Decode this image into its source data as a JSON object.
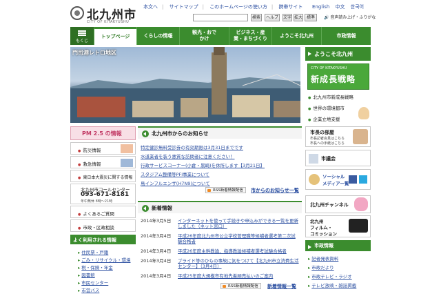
{
  "header": {
    "logo_title": "北九州市",
    "logo_sub": "CITY OF KITAKYUSHU",
    "links": [
      "本文へ",
      "サイトマップ",
      "このホームページの使い方",
      "携帯サイト"
    ],
    "lang": [
      "English",
      "中文",
      "한국어"
    ],
    "search_button": "検索",
    "help_button": "ヘルプ",
    "text_button": "文字",
    "zoom_button": "拡大",
    "standard_button": "標準",
    "voice": "音声読み上げ・ふりがな"
  },
  "nav": {
    "menu": "もくじ",
    "items": [
      "トップページ",
      "くらしの情報",
      "観光・おでかけ",
      "ビジネス・産業・まちづくり",
      "ようこそ北九州",
      "市政情報"
    ]
  },
  "hero": {
    "label": "門司港レトロ地区"
  },
  "right": {
    "welcome": "ようこそ北九州",
    "banner_sub": "CITY OF KITAKYUSHU",
    "banner_title": "新成長戦略",
    "list": [
      "北九州市新成長戦略",
      "世界の環境都市",
      "企業立地支援"
    ],
    "mayor_title": "市長の部屋",
    "mayor_sub": [
      "市長記者会見はこちら",
      "市長への手紙はこちら"
    ],
    "council": "市議会",
    "social": [
      "ソーシャル",
      "メディア一覧"
    ],
    "channel": "北九州チャンネル",
    "film": [
      "北九州",
      "フィルム・",
      "コミッション"
    ],
    "shisei": "市政情報",
    "shisei_links": [
      "記者発表資料",
      "市政だより",
      "市政テレビ・ラジオ",
      "テレビ放映・雑誌掲載"
    ]
  },
  "left": {
    "pm": "PM 2.5 の情報",
    "items": [
      "防災情報",
      "救急情報",
      "東日本大震災に関する情報"
    ],
    "callcenter": "北九州市コールセンター",
    "phone": "093-671-8181",
    "hours": "年中無休 8時～21時",
    "faq": "よくあるご質問",
    "window": "市政・区政相談",
    "popular": "よく利用される情報",
    "popular_links": [
      "住民票・戸籍",
      "ごみ・リサイクル・環境",
      "税・保険・年金",
      "図書館",
      "市民センター",
      "市営バス"
    ]
  },
  "notices": {
    "title": "北九州市からのお知らせ",
    "items": [
      "特定健診無料受診券の有効期限は3月31日までです",
      "水道業者を装う悪質な訪問者に注意ください！",
      "行政サービスコーナー(小倉・黒崎)を休所します【3月21日】",
      "スタジアム整備等PFI事業について",
      "鳥インフルエンザ(H7N9)について"
    ],
    "rss": "RSS新着情報配信",
    "more": "市からのお知らせ一覧"
  },
  "news": {
    "title": "新着情報",
    "rows": [
      {
        "date": "2014年3月5日",
        "text": "インターネットを使って手続きや申込みができる一覧を更新しました（ネット窓口）"
      },
      {
        "date": "2014年3月4日",
        "text": "平成26年度北九州市公立学校管理職等候補者選考第二次試験合格者"
      },
      {
        "date": "2014年3月4日",
        "text": "平成26年度主幹教論、指導教論候補者選考試験合格者"
      },
      {
        "date": "2014年3月4日",
        "text": "プライド等のひもの事故に気をつけて【北九州市立消費生活センター】（3月4日）"
      },
      {
        "date": "2014年3月4日",
        "text": "平成25年度大規模市有地先着順売払いのご案内"
      }
    ],
    "rss": "RSS新着情報配信",
    "more": "新着情報一覧"
  },
  "colors": {
    "accent": "#3b8c2e",
    "link": "#2a4ea0",
    "pm": "#c23b66"
  }
}
